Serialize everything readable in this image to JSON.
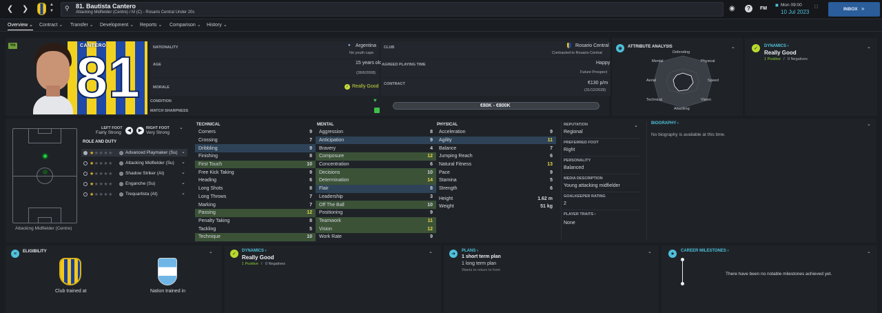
{
  "topbar": {
    "player_title": "81. Bautista Cantero",
    "player_subtitle": "Attacking Midfielder (Centre) / M (C) - Rosario Central Under 20s",
    "fm_label": "FM",
    "date_day": "Mon 09:00",
    "date": "10 Jul 2023",
    "inbox_label": "INBOX"
  },
  "tabs": [
    "Overview",
    "Contract",
    "Transfer",
    "Development",
    "Reports",
    "Comparison",
    "History"
  ],
  "profile": {
    "youth_badge": "Yth",
    "shirt_name": "CANTERO",
    "shirt_number": "81",
    "nationality_label": "NATIONALITY",
    "nationality": "Argentina",
    "youth_caps": "No youth caps",
    "club_label": "CLUB",
    "club": "Rosario Central",
    "club_contract": "Contracted to Rosario Central",
    "age_label": "AGE",
    "age": "15 years old",
    "dob": "(28/6/2008)",
    "playing_time_label": "AGREED PLAYING TIME",
    "happiness": "Happy",
    "playing_time": "Future Prospect",
    "morale_label": "MORALE",
    "morale": "Really Good",
    "contract_label": "CONTRACT",
    "wage": "€130 p/m",
    "contract_end": "(31/12/2028)",
    "condition_label": "CONDITION",
    "sharpness_label": "MATCH SHARPNESS",
    "value_range": "€80K - €800K"
  },
  "attribute_analysis": {
    "title": "ATTRIBUTE ANALYSIS",
    "axes": [
      "Defending",
      "Physical",
      "Speed",
      "Vision",
      "Attacking",
      "Technical",
      "Aerial",
      "Mental"
    ]
  },
  "dynamics_top": {
    "title": "DYNAMICS",
    "value": "Really Good",
    "positives": "1 Positive",
    "sep": "/",
    "negatives": "0 Negatives"
  },
  "position": {
    "left_foot_label": "LEFT FOOT",
    "left_foot": "Fairly Strong",
    "right_foot_label": "RIGHT FOOT",
    "right_foot": "Very Strong",
    "role_title": "ROLE AND DUTY",
    "roles": [
      "Advanced Playmaker (Su)",
      "Attacking Midfielder (Su)",
      "Shadow Striker (At)",
      "Enganche (Su)",
      "Trequartista (At)"
    ],
    "pitch_label": "Attacking Midfielder (Centre)"
  },
  "technical": {
    "title": "TECHNICAL",
    "rows": [
      {
        "name": "Corners",
        "value": "9"
      },
      {
        "name": "Crossing",
        "value": "7"
      },
      {
        "name": "Dribbling",
        "value": "9"
      },
      {
        "name": "Finishing",
        "value": "8"
      },
      {
        "name": "First Touch",
        "value": "10"
      },
      {
        "name": "Free Kick Taking",
        "value": "9"
      },
      {
        "name": "Heading",
        "value": "6"
      },
      {
        "name": "Long Shots",
        "value": "8"
      },
      {
        "name": "Long Throws",
        "value": "7"
      },
      {
        "name": "Marking",
        "value": "7"
      },
      {
        "name": "Passing",
        "value": "12"
      },
      {
        "name": "Penalty Taking",
        "value": "8"
      },
      {
        "name": "Tackling",
        "value": "5"
      },
      {
        "name": "Technique",
        "value": "10"
      }
    ]
  },
  "mental": {
    "title": "MENTAL",
    "rows": [
      {
        "name": "Aggression",
        "value": "8"
      },
      {
        "name": "Anticipation",
        "value": "9"
      },
      {
        "name": "Bravery",
        "value": "4"
      },
      {
        "name": "Composure",
        "value": "12"
      },
      {
        "name": "Concentration",
        "value": "6"
      },
      {
        "name": "Decisions",
        "value": "10"
      },
      {
        "name": "Determination",
        "value": "14"
      },
      {
        "name": "Flair",
        "value": "8"
      },
      {
        "name": "Leadership",
        "value": "3"
      },
      {
        "name": "Off The Ball",
        "value": "10"
      },
      {
        "name": "Positioning",
        "value": "9"
      },
      {
        "name": "Teamwork",
        "value": "11"
      },
      {
        "name": "Vision",
        "value": "12"
      },
      {
        "name": "Work Rate",
        "value": "9"
      }
    ]
  },
  "physical": {
    "title": "PHYSICAL",
    "rows": [
      {
        "name": "Acceleration",
        "value": "9"
      },
      {
        "name": "Agility",
        "value": "11"
      },
      {
        "name": "Balance",
        "value": "7"
      },
      {
        "name": "Jumping Reach",
        "value": "6"
      },
      {
        "name": "Natural Fitness",
        "value": "13"
      },
      {
        "name": "Pace",
        "value": "9"
      },
      {
        "name": "Stamina",
        "value": "5"
      },
      {
        "name": "Strength",
        "value": "6"
      }
    ],
    "height_label": "Height",
    "height": "1.62 m",
    "weight_label": "Weight",
    "weight": "51 kg"
  },
  "info": {
    "reputation_label": "REPUTATION",
    "reputation": "Regional",
    "preferred_foot_label": "PREFERRED FOOT",
    "preferred_foot": "Right",
    "personality_label": "PERSONALITY",
    "personality": "Balanced",
    "media_label": "MEDIA DESCRIPTION",
    "media": "Young attacking midfielder",
    "gk_label": "GOALKEEPER RATING",
    "gk": "2",
    "traits_label": "PLAYER TRAITS",
    "traits": "None"
  },
  "biography": {
    "title": "BIOGRAPHY",
    "text": "No biography is available at this time."
  },
  "eligibility": {
    "title": "ELIGIBILITY",
    "club_trained": "Club trained at",
    "nation_trained": "Nation trained in"
  },
  "dynamics_bottom": {
    "title": "DYNAMICS",
    "value": "Really Good",
    "positives": "1 Positive",
    "sep": "/",
    "negatives": "0 Negatives"
  },
  "plans": {
    "title": "PLANS",
    "short": "1 short term plan",
    "long": "1 long term plan",
    "note": "Wants to return to form"
  },
  "milestones": {
    "title": "CAREER MILESTONES",
    "text": "There have been no notable milestones achieved yet."
  },
  "colors": {
    "accent_green": "#8bd22f",
    "accent_cyan": "#4fc1db",
    "inbox_blue": "#2a5d9a",
    "highlight_blue": "#2e4357",
    "highlight_green": "#3b5237"
  }
}
